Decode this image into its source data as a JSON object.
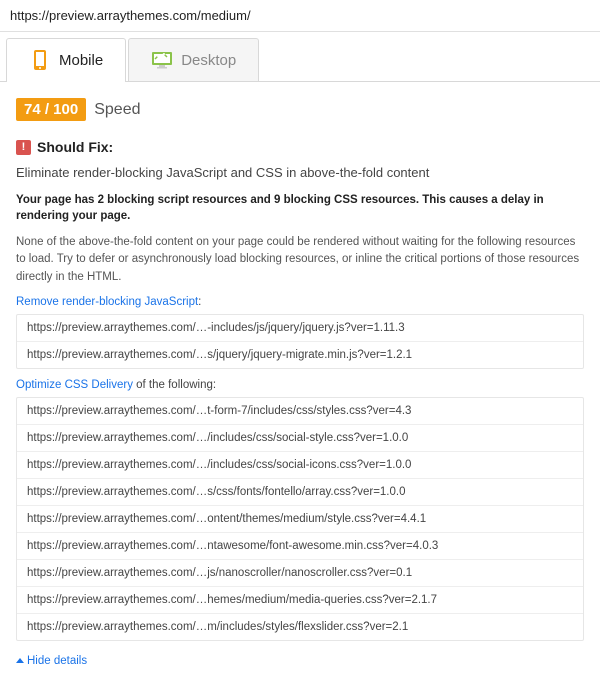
{
  "url": "https://preview.arraythemes.com/medium/",
  "tabs": {
    "mobile": "Mobile",
    "desktop": "Desktop"
  },
  "score": {
    "badge": "74 / 100",
    "label": "Speed"
  },
  "rule": {
    "heading": "Should Fix:",
    "title": "Eliminate render-blocking JavaScript and CSS in above-the-fold content",
    "summary": "Your page has 2 blocking script resources and 9 blocking CSS resources. This causes a delay in rendering your page.",
    "explain": "None of the above-the-fold content on your page could be rendered without waiting for the following resources to load. Try to defer or asynchronously load blocking resources, or inline the critical portions of those resources directly in the HTML.",
    "js_link": "Remove render-blocking JavaScript",
    "js_link_after": ":",
    "css_link": "Optimize CSS Delivery",
    "css_link_after": " of the following:",
    "hide_details": "Hide details"
  },
  "js_resources": [
    "https://preview.arraythemes.com/…-includes/js/jquery/jquery.js?ver=1.11.3",
    "https://preview.arraythemes.com/…s/jquery/jquery-migrate.min.js?ver=1.2.1"
  ],
  "css_resources": [
    "https://preview.arraythemes.com/…t-form-7/includes/css/styles.css?ver=4.3",
    "https://preview.arraythemes.com/…/includes/css/social-style.css?ver=1.0.0",
    "https://preview.arraythemes.com/…/includes/css/social-icons.css?ver=1.0.0",
    "https://preview.arraythemes.com/…s/css/fonts/fontello/array.css?ver=1.0.0",
    "https://preview.arraythemes.com/…ontent/themes/medium/style.css?ver=4.4.1",
    "https://preview.arraythemes.com/…ntawesome/font-awesome.min.css?ver=4.0.3",
    "https://preview.arraythemes.com/…js/nanoscroller/nanoscroller.css?ver=0.1",
    "https://preview.arraythemes.com/…hemes/medium/media-queries.css?ver=2.1.7",
    "https://preview.arraythemes.com/…m/includes/styles/flexslider.css?ver=2.1"
  ]
}
